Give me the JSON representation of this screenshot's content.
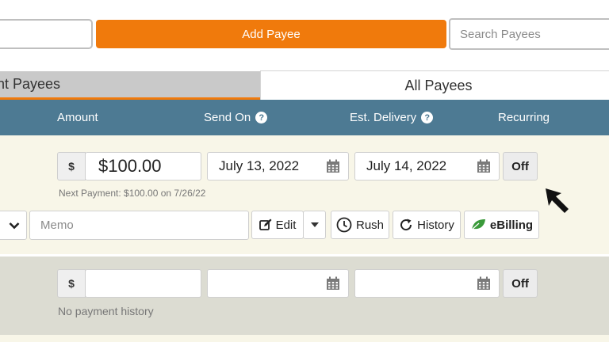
{
  "toolbar": {
    "add_payee_label": "Add Payee",
    "search_placeholder": "Search Payees"
  },
  "tabs": [
    {
      "label": "Frequent Payees",
      "visible_label": "ent Payees",
      "active": true
    },
    {
      "label": "All Payees",
      "active": false
    }
  ],
  "table_header": {
    "amount": "Amount",
    "send_on": "Send On",
    "est_delivery": "Est. Delivery",
    "recurring": "Recurring"
  },
  "payments": [
    {
      "currency_symbol": "$",
      "amount": "$100.00",
      "send_on": "July 13, 2022",
      "est_delivery": "July 14, 2022",
      "recurring": "Off",
      "note": "Next Payment: $100.00 on 7/26/22",
      "memo_placeholder": "Memo",
      "actions": {
        "edit": "Edit",
        "rush": "Rush",
        "history": "History",
        "ebilling": "eBilling"
      }
    },
    {
      "currency_symbol": "$",
      "amount": "",
      "send_on": "",
      "est_delivery": "",
      "recurring": "Off",
      "note": "No payment history"
    }
  ],
  "colors": {
    "accent_orange": "#f07a0c",
    "header_blue": "#4d7a93",
    "row_cream": "#f8f6e8",
    "row_grey": "#dcdcd2",
    "ebilling_leaf": "#3a9a3a"
  },
  "icons": [
    "question-icon",
    "calendar-icon",
    "edit-icon",
    "caret-down-icon",
    "clock-icon",
    "refresh-icon",
    "leaf-icon",
    "cursor-arrow-icon",
    "chevron-down-icon"
  ]
}
